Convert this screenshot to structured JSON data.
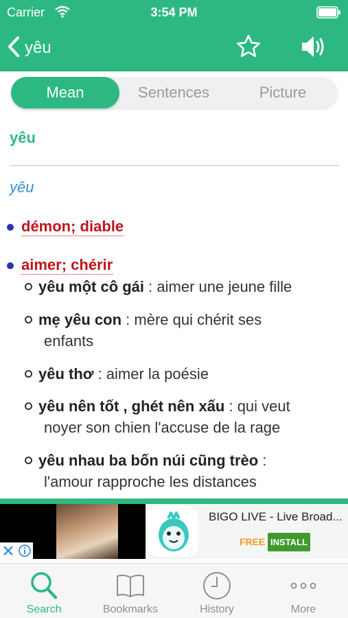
{
  "status_bar": {
    "carrier": "Carrier",
    "time": "3:54 PM"
  },
  "nav": {
    "back_icon": "chevron-left-icon",
    "title": "yêu",
    "star_icon": "star-icon",
    "speaker_icon": "speaker-icon"
  },
  "segments": [
    {
      "label": "Mean",
      "active": true
    },
    {
      "label": "Sentences",
      "active": false
    },
    {
      "label": "Picture",
      "active": false
    }
  ],
  "entry": {
    "headword": "yêu",
    "phonetic": "yêu",
    "senses": [
      {
        "text": "démon; diable",
        "examples": []
      },
      {
        "text": "aimer; chérir",
        "examples": [
          {
            "vi": "yêu một cô gái",
            "fr": " : aimer une jeune fille",
            "fr2": ""
          },
          {
            "vi": "mẹ yêu con",
            "fr": " : mère qui chérit ses",
            "fr2": "enfants"
          },
          {
            "vi": "yêu thơ",
            "fr": " : aimer la poésie",
            "fr2": ""
          },
          {
            "vi": "yêu nên tốt , ghét nên xấu",
            "fr": " : qui veut",
            "fr2": "noyer son chien l'accuse de la rage"
          },
          {
            "vi": "yêu nhau ba bốn núi cũng trèo",
            "fr": " :",
            "fr2": "l'amour rapproche les distances"
          }
        ]
      }
    ]
  },
  "ad": {
    "title": "BIGO LIVE - Live Broad...",
    "free": "FREE",
    "install": "INSTALL",
    "colors": {
      "accent": "#2db882",
      "install": "#3f9b2e",
      "free": "#f39a1e"
    }
  },
  "tabs": [
    {
      "label": "Search",
      "icon": "search-icon",
      "active": true
    },
    {
      "label": "Bookmarks",
      "icon": "book-icon",
      "active": false
    },
    {
      "label": "History",
      "icon": "clock-icon",
      "active": false
    },
    {
      "label": "More",
      "icon": "more-icon",
      "active": false
    }
  ]
}
